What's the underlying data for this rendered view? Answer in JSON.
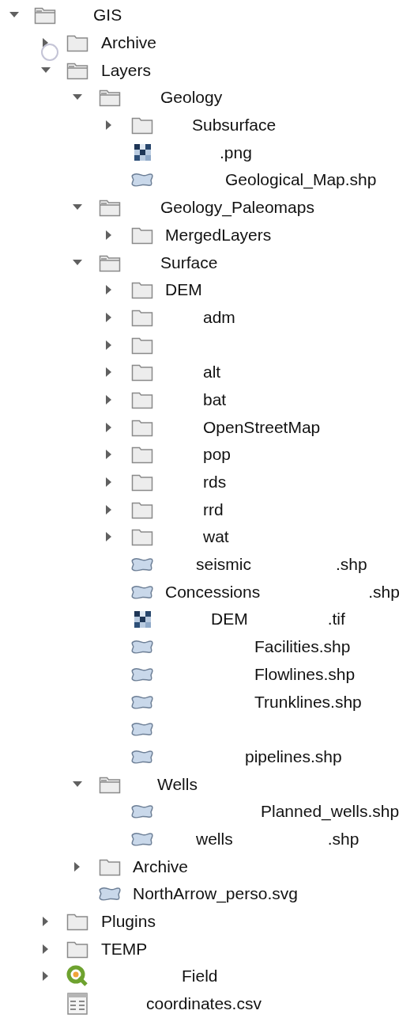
{
  "tree": [
    {
      "kind": "folder",
      "label": "GIS",
      "expanded": true,
      "children": [
        {
          "kind": "folder",
          "label": "Archive",
          "expanded": false,
          "loading": true
        },
        {
          "kind": "folder",
          "label": "Layers",
          "expanded": true,
          "children": [
            {
              "kind": "folder",
              "label": "Geology",
              "expanded": true,
              "children": [
                {
                  "kind": "folder",
                  "label": "Subsurface",
                  "expanded": false
                },
                {
                  "kind": "raster",
                  "label": ".png"
                },
                {
                  "kind": "vector",
                  "label": "Geological_Map.shp"
                }
              ]
            },
            {
              "kind": "folder",
              "label": "Geology_Paleomaps",
              "expanded": true,
              "children": [
                {
                  "kind": "folder",
                  "label": "MergedLayers",
                  "expanded": false
                }
              ]
            },
            {
              "kind": "folder",
              "label": "Surface",
              "expanded": true,
              "children": [
                {
                  "kind": "folder",
                  "label": "DEM",
                  "expanded": false
                },
                {
                  "kind": "folder",
                  "label": "adm",
                  "expanded": false
                },
                {
                  "kind": "folder",
                  "expanded": false
                },
                {
                  "kind": "folder",
                  "label": "alt",
                  "expanded": false
                },
                {
                  "kind": "folder",
                  "label": "bat",
                  "expanded": false
                },
                {
                  "kind": "folder",
                  "label": "OpenStreetMap",
                  "expanded": false
                },
                {
                  "kind": "folder",
                  "label": "pop",
                  "expanded": false
                },
                {
                  "kind": "folder",
                  "label": "rds",
                  "expanded": false
                },
                {
                  "kind": "folder",
                  "label": "rrd",
                  "expanded": false
                },
                {
                  "kind": "folder",
                  "label": "wat",
                  "expanded": false
                },
                {
                  "kind": "vector",
                  "label": "seismic",
                  "suffix": ".shp"
                },
                {
                  "kind": "vector",
                  "label": "Concessions",
                  "suffix": ".shp"
                },
                {
                  "kind": "raster",
                  "label": "DEM",
                  "suffix": ".tif"
                },
                {
                  "kind": "vector",
                  "label": "Facilities.shp"
                },
                {
                  "kind": "vector",
                  "label": "Flowlines.shp"
                },
                {
                  "kind": "vector",
                  "label": "Trunklines.shp"
                },
                {
                  "kind": "vector"
                },
                {
                  "kind": "vector",
                  "label": "pipelines.shp"
                }
              ]
            },
            {
              "kind": "folder",
              "label": "Wells",
              "expanded": true,
              "children": [
                {
                  "kind": "vector",
                  "label": "Planned_wells.shp"
                },
                {
                  "kind": "vector",
                  "label": "wells",
                  "suffix": ".shp"
                }
              ]
            },
            {
              "kind": "folder",
              "label": "Archive",
              "expanded": false
            },
            {
              "kind": "vector",
              "label": "NorthArrow_perso.svg"
            }
          ]
        },
        {
          "kind": "folder",
          "label": "Plugins",
          "expanded": false
        },
        {
          "kind": "folder",
          "label": "TEMP",
          "expanded": false
        },
        {
          "kind": "project",
          "label": "Field",
          "expanded": false
        },
        {
          "kind": "table",
          "label": "coordinates.csv"
        }
      ]
    }
  ]
}
